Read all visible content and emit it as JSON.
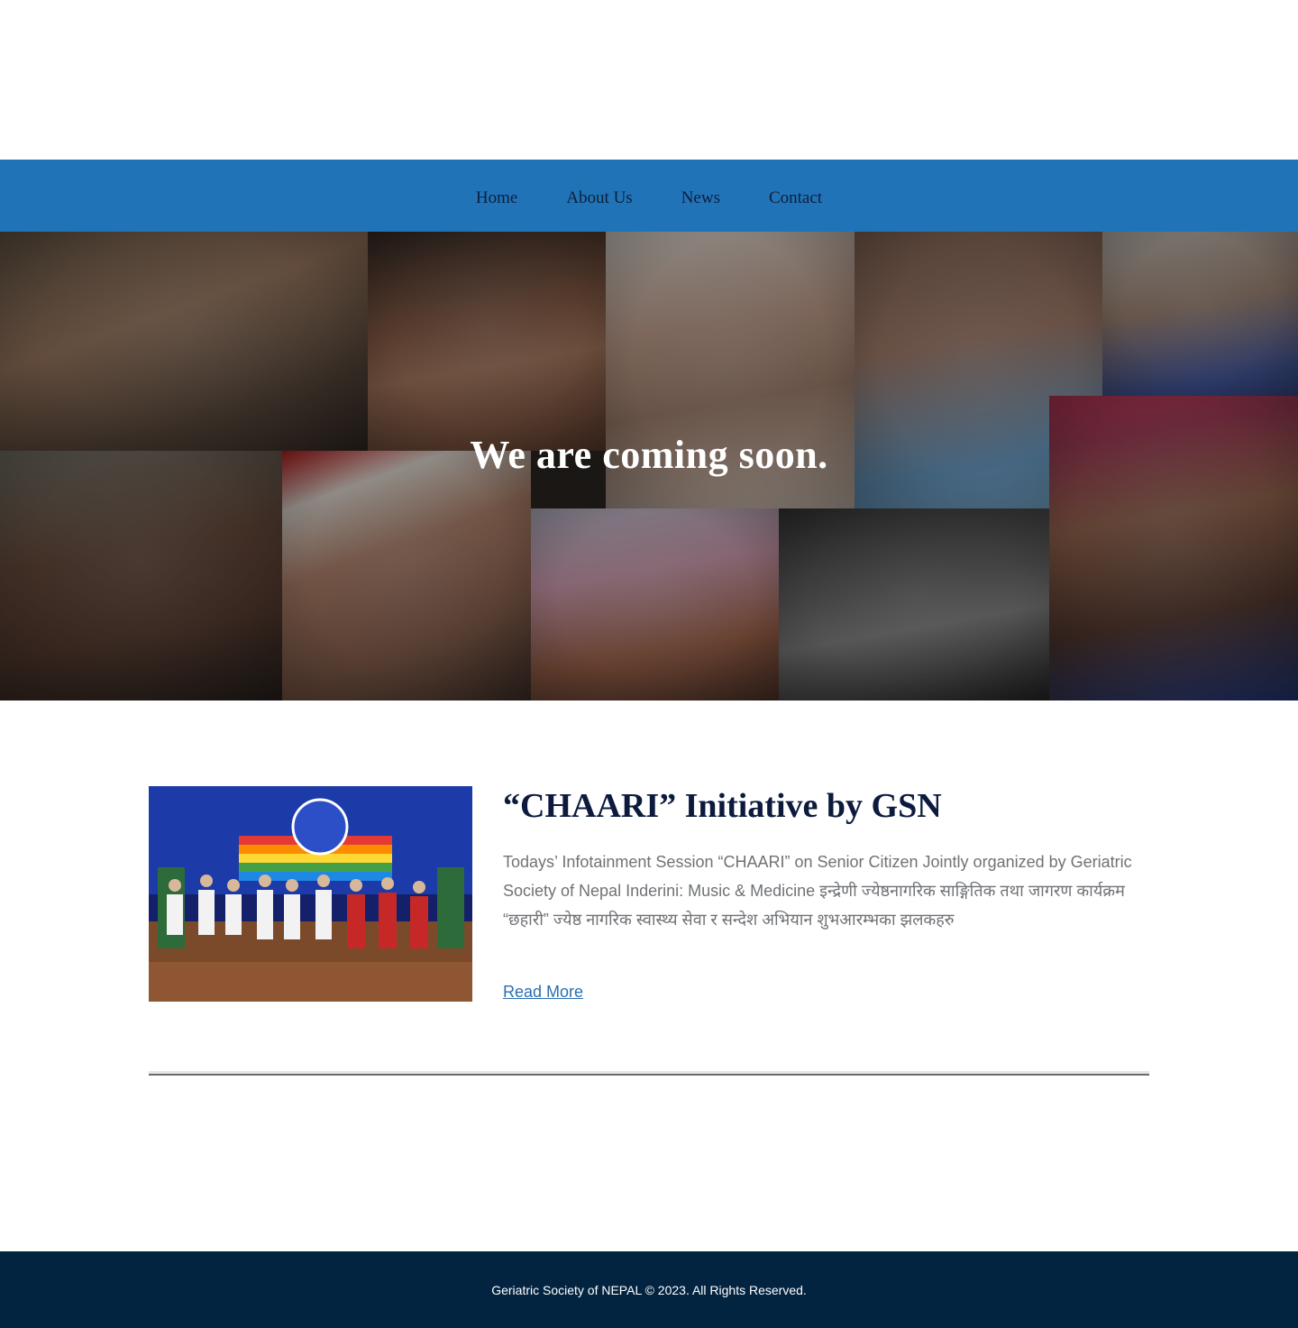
{
  "nav": {
    "items": [
      {
        "label": "Home"
      },
      {
        "label": "About Us"
      },
      {
        "label": "News"
      },
      {
        "label": "Contact"
      }
    ]
  },
  "hero": {
    "title": "We are coming soon."
  },
  "post": {
    "title": "“CHAARI” Initiative by GSN",
    "excerpt": "Todays’ Infotainment Session “CHAARI” on Senior Citizen Jointly organized by Geriatric Society of Nepal Inderini: Music & Medicine इन्द्रेणी ज्येष्ठनागरिक साङ्गितिक तथा जागरण कार्यक्रम “छहारी” ज्येष्ठ नागरिक स्वास्थ्य सेवा र सन्देश अभियान शुभआरम्भका झलकहरु",
    "read_more": "Read More"
  },
  "footer": {
    "copyright": "Geriatric Society of NEPAL © 2023. All Rights Reserved."
  },
  "colors": {
    "nav_bg": "#2173b8",
    "footer_bg": "#032440",
    "link": "#2a6fb0",
    "title": "#0c1a3d"
  }
}
